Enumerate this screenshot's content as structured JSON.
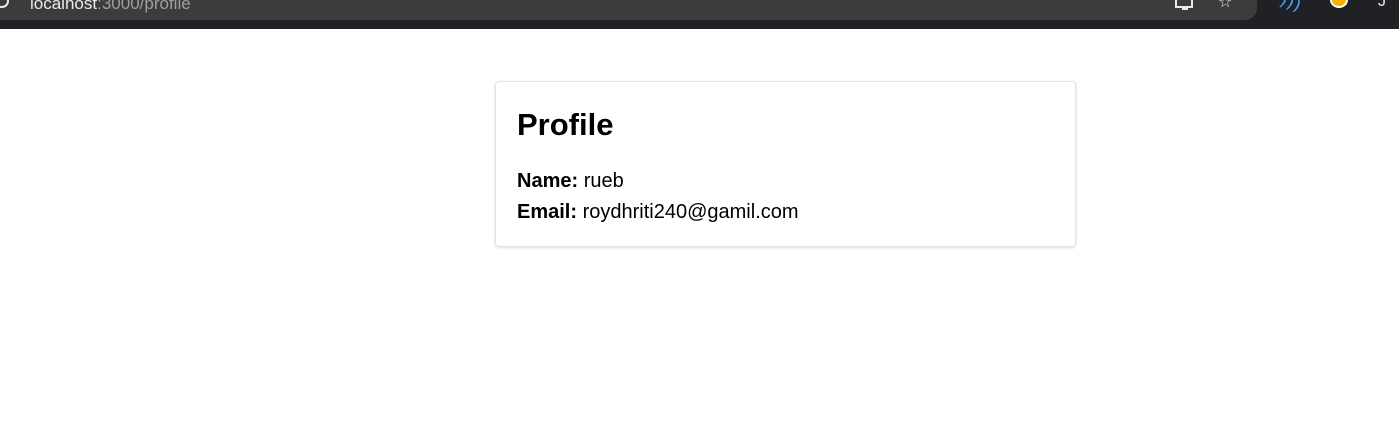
{
  "browser": {
    "url_host": "localhost",
    "url_rest": ":3000/profile",
    "profile_initial": "J"
  },
  "icons": {
    "site_info": "info-icon",
    "cast": "cast-icon",
    "bookmark": "star-icon",
    "extension": "wifi-extension-icon",
    "avatar": "avatar-icon"
  },
  "profile": {
    "title": "Profile",
    "name_label": "Name:",
    "name_value": "rueb",
    "email_label": "Email:",
    "email_value": "roydhriti240@gamil.com"
  }
}
